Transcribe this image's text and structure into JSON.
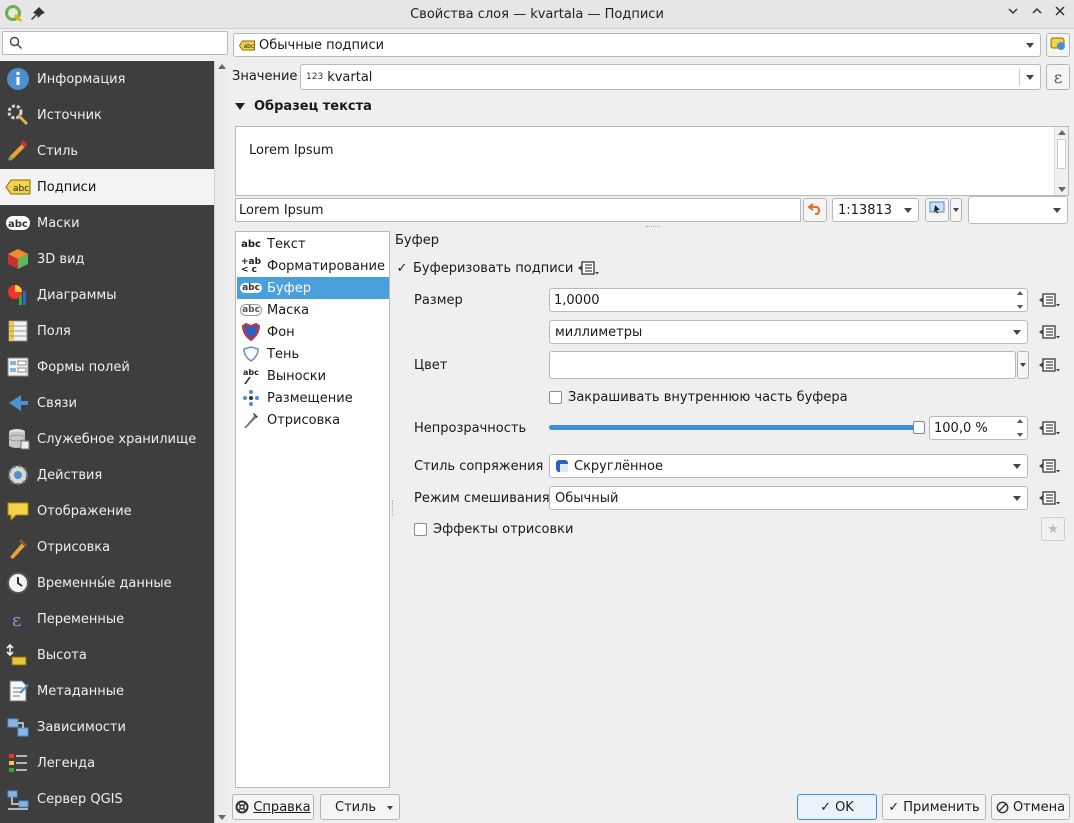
{
  "window": {
    "title": "Свойства слоя — kvartala — Подписи"
  },
  "sidebar": {
    "search_placeholder": "",
    "items": [
      {
        "label": "Информация",
        "icon": "info-icon"
      },
      {
        "label": "Источник",
        "icon": "source-icon"
      },
      {
        "label": "Стиль",
        "icon": "style-icon"
      },
      {
        "label": "Подписи",
        "icon": "labels-icon",
        "active": true
      },
      {
        "label": "Маски",
        "icon": "masks-icon"
      },
      {
        "label": "3D вид",
        "icon": "3d-view-icon"
      },
      {
        "label": "Диаграммы",
        "icon": "diagrams-icon"
      },
      {
        "label": "Поля",
        "icon": "fields-icon"
      },
      {
        "label": "Формы полей",
        "icon": "field-forms-icon"
      },
      {
        "label": "Связи",
        "icon": "joins-icon"
      },
      {
        "label": "Служебное хранилище",
        "icon": "auxiliary-storage-icon"
      },
      {
        "label": "Действия",
        "icon": "actions-icon"
      },
      {
        "label": "Отображение",
        "icon": "display-icon"
      },
      {
        "label": "Отрисовка",
        "icon": "rendering-icon"
      },
      {
        "label": "Временны́е данные",
        "icon": "temporal-icon"
      },
      {
        "label": "Переменные",
        "icon": "variables-icon"
      },
      {
        "label": "Высота",
        "icon": "elevation-icon"
      },
      {
        "label": "Метаданные",
        "icon": "metadata-icon"
      },
      {
        "label": "Зависимости",
        "icon": "dependencies-icon"
      },
      {
        "label": "Легенда",
        "icon": "legend-icon"
      },
      {
        "label": "Сервер QGIS",
        "icon": "qgis-server-icon"
      }
    ]
  },
  "labels": {
    "mode": "Обычные подписи",
    "value_label": "Значение",
    "value_type": "123",
    "value": "kvartal",
    "sample_section": "Образец текста",
    "sample_preview": "Lorem Ipsum",
    "sample_input": "Lorem Ipsum",
    "scale": "1:13813",
    "scale_extra": ""
  },
  "tabs": [
    {
      "label": "Текст",
      "icon": "text-icon"
    },
    {
      "label": "Форматирование",
      "icon": "formatting-icon"
    },
    {
      "label": "Буфер",
      "icon": "buffer-icon",
      "active": true
    },
    {
      "label": "Маска",
      "icon": "mask-icon"
    },
    {
      "label": "Фон",
      "icon": "background-icon"
    },
    {
      "label": "Тень",
      "icon": "shadow-icon"
    },
    {
      "label": "Выноски",
      "icon": "callouts-icon"
    },
    {
      "label": "Размещение",
      "icon": "placement-icon"
    },
    {
      "label": "Отрисовка",
      "icon": "render-icon"
    }
  ],
  "buffer": {
    "section_title": "Буфер",
    "draw_buffer_label": "Буферизовать подписи",
    "draw_buffer_checked": true,
    "size_label": "Размер",
    "size_value": "1,0000",
    "size_unit": "миллиметры",
    "color_label": "Цвет",
    "color_value": "#ffffff",
    "fill_interior_label": "Закрашивать внутреннюю часть буфера",
    "fill_interior_checked": false,
    "opacity_label": "Непрозрачность",
    "opacity_value": "100,0 %",
    "opacity_fraction": 1.0,
    "join_style_label": "Стиль сопряжения",
    "join_style_value": "Скруглённое",
    "blend_mode_label": "Режим смешивания",
    "blend_mode_value": "Обычный",
    "effects_label": "Эффекты отрисовки",
    "effects_checked": false
  },
  "footer": {
    "help_label": "Справка",
    "style_label": "Стиль",
    "ok_label": "OK",
    "apply_label": "Применить",
    "cancel_label": "Отмена"
  },
  "colors": {
    "sidebar_bg": "#3e3e3e",
    "selection": "#4a9fdd",
    "accent_blue": "#3d8fd6"
  }
}
